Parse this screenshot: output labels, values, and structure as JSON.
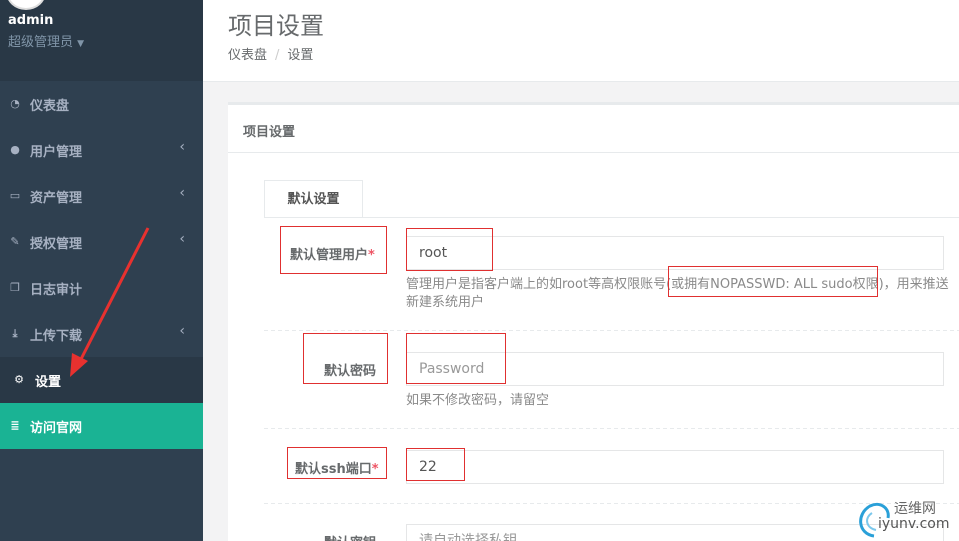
{
  "profile": {
    "name": "admin",
    "role": "超级管理员"
  },
  "nav": [
    {
      "label": "仪表盘",
      "icon": "dashboard-icon",
      "chevron": false,
      "glyph": "◔"
    },
    {
      "label": "用户管理",
      "icon": "users-icon",
      "chevron": true,
      "glyph": "●"
    },
    {
      "label": "资产管理",
      "icon": "inbox-icon",
      "chevron": true,
      "glyph": "▭"
    },
    {
      "label": "授权管理",
      "icon": "edit-icon",
      "chevron": true,
      "glyph": "✎"
    },
    {
      "label": "日志审计",
      "icon": "copy-icon",
      "chevron": false,
      "glyph": "❐"
    },
    {
      "label": "上传下载",
      "icon": "download-icon",
      "chevron": true,
      "glyph": "⤓"
    },
    {
      "label": "设置",
      "icon": "gears-icon",
      "chevron": false,
      "glyph": "⚙"
    },
    {
      "label": "访问官网",
      "icon": "database-icon",
      "chevron": false,
      "glyph": "≣"
    }
  ],
  "chevron_glyph": "‹",
  "header": {
    "title": "项目设置",
    "breadcrumb": [
      "仪表盘",
      "设置"
    ],
    "breadcrumb_sep": "/"
  },
  "panel": {
    "title": "项目设置",
    "tab": "默认设置"
  },
  "form": {
    "admin_user": {
      "label": "默认管理用户",
      "required_mark": "*",
      "value": "root",
      "help_line1": "管理用户是指客户端上的如root等高权限账号(或拥有NOPASSWD: ALL sudo权限)，用来推送",
      "help_line2": "新建系统用户"
    },
    "password": {
      "label": "默认密码",
      "placeholder": "Password",
      "help": "如果不修改密码，请留空"
    },
    "ssh_port": {
      "label": "默认ssh端口",
      "required_mark": "*",
      "value": "22"
    },
    "private_key": {
      "label": "默认密钥",
      "placeholder": "请自动选择私钥"
    }
  },
  "watermark": {
    "line1": "运维网",
    "line2": "iyunv.com"
  }
}
